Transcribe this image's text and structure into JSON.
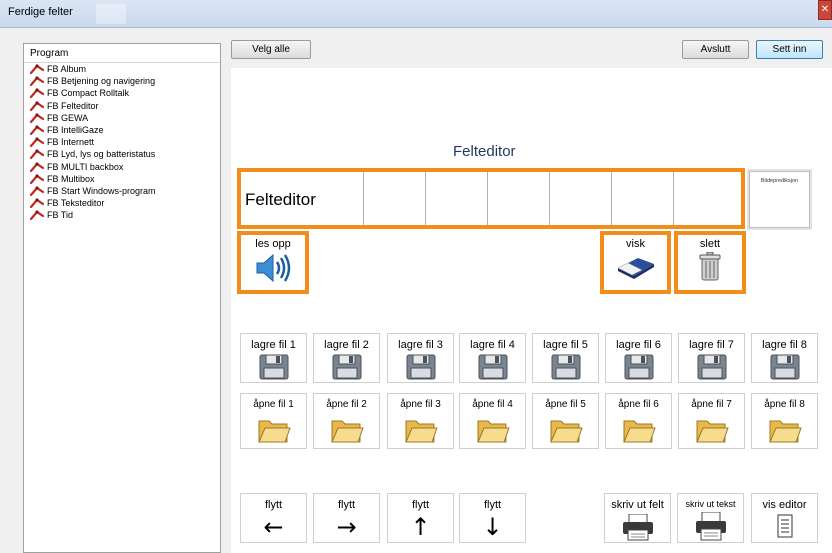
{
  "window": {
    "title": "Ferdige felter"
  },
  "program_list": {
    "header": "Program",
    "items": [
      "FB Album",
      "FB Betjening og navigering",
      "FB Compact Rolltalk",
      "FB Felteditor",
      "FB GEWA",
      "FB IntelliGaze",
      "FB Internett",
      "FB Lyd, lys og batteristatus",
      "FB MULTI backbox",
      "FB Multibox",
      "FB Start Windows-program",
      "FB Teksteditor",
      "FB Tid"
    ]
  },
  "toolbar": {
    "select_all": "Velg alle",
    "exit": "Avslutt",
    "insert": "Sett inn"
  },
  "editor": {
    "title": "Felteditor",
    "text_value": "Felteditor",
    "prediction_label": "Bildeprediksjon",
    "read_label": "les opp",
    "erase_label": "visk",
    "delete_label": "slett"
  },
  "save_buttons": [
    "lagre fil 1",
    "lagre fil 2",
    "lagre fil 3",
    "lagre fil 4",
    "lagre fil 5",
    "lagre fil 6",
    "lagre fil 7",
    "lagre fil 8"
  ],
  "open_buttons": [
    "åpne fil 1",
    "åpne fil 2",
    "åpne fil 3",
    "åpne fil 4",
    "åpne fil 5",
    "åpne fil 6",
    "åpne fil 7",
    "åpne fil 8"
  ],
  "move_buttons": [
    {
      "label": "flytt",
      "arrow": "←"
    },
    {
      "label": "flytt",
      "arrow": "→"
    },
    {
      "label": "flytt",
      "arrow": "↑"
    },
    {
      "label": "flytt",
      "arrow": "↓"
    }
  ],
  "action_buttons": {
    "print_field": "skriv ut felt",
    "print_text": "skriv ut tekst",
    "show_editor": "vis editor"
  },
  "colors": {
    "accent_orange": "#f28c1a",
    "title_blue": "#1f3a5f"
  }
}
